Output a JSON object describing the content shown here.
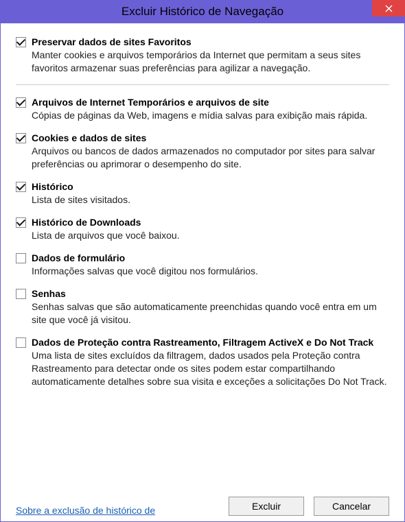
{
  "window": {
    "title": "Excluir Histórico de Navegação"
  },
  "options": {
    "favorites": {
      "checked": true,
      "title": "Preservar dados de sites Favoritos",
      "desc": "Manter cookies e arquivos temporários da Internet que permitam a seus sites favoritos armazenar suas preferências para agilizar a navegação."
    },
    "tempFiles": {
      "checked": true,
      "title": "Arquivos de Internet Temporários e arquivos de site",
      "desc": "Cópias de páginas da Web, imagens e mídia salvas para exibição mais rápida."
    },
    "cookies": {
      "checked": true,
      "title": "Cookies e dados de sites",
      "desc": "Arquivos ou bancos de dados armazenados no computador por sites para salvar preferências ou aprimorar o desempenho do site."
    },
    "history": {
      "checked": true,
      "title": "Histórico",
      "desc": "Lista de sites visitados."
    },
    "downloads": {
      "checked": true,
      "title": "Histórico de Downloads",
      "desc": "Lista de arquivos que você baixou."
    },
    "formData": {
      "checked": false,
      "title": "Dados de formulário",
      "desc": "Informações salvas que você digitou nos formulários."
    },
    "passwords": {
      "checked": false,
      "title": "Senhas",
      "desc": "Senhas salvas que são automaticamente preenchidas quando você entra em um site que você já visitou."
    },
    "tracking": {
      "checked": false,
      "title": "Dados de Proteção contra Rastreamento, Filtragem ActiveX e Do Not Track",
      "desc": "Uma lista de sites excluídos da filtragem, dados usados pela Proteção contra Rastreamento para detectar onde os sites podem estar compartilhando automaticamente detalhes sobre sua visita e exceções a solicitações Do Not Track."
    }
  },
  "footer": {
    "helpLink": "Sobre a exclusão de histórico de",
    "deleteBtn": "Excluir",
    "cancelBtn": "Cancelar"
  }
}
